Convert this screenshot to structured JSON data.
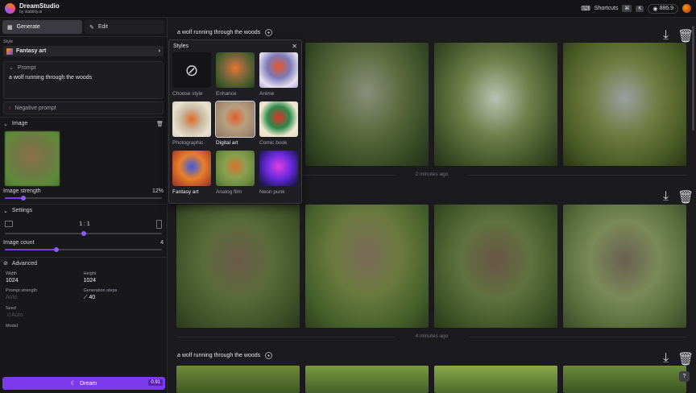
{
  "app": {
    "title": "DreamStudio",
    "subtitle": "by stability.ai"
  },
  "topbar": {
    "shortcuts_label": "Shortcuts",
    "kbd1": "⌘",
    "kbd2": "K",
    "credits": "886.9"
  },
  "tabs": [
    {
      "label": "Generate"
    },
    {
      "label": "Edit"
    }
  ],
  "style": {
    "label": "Style",
    "value": "Fantasy art"
  },
  "prompt": {
    "label": "Prompt",
    "text": "a wolf running through the woods"
  },
  "negative_prompt": {
    "label": "Negative prompt"
  },
  "image": {
    "label": "Image",
    "strength_label": "Image strength",
    "strength_value": "12%",
    "strength_fraction": 0.12
  },
  "settings": {
    "label": "Settings",
    "ratio": "1 : 1",
    "ratio_fraction": 0.5,
    "image_count_label": "Image count",
    "image_count": "4",
    "image_count_fraction": 0.33,
    "advanced_label": "Advanced",
    "width_label": "Width",
    "width": "1024",
    "height_label": "Height",
    "height": "1024",
    "prompt_strength_label": "Prompt strength",
    "prompt_strength": "Auto",
    "steps_label": "Generation steps",
    "steps": "40",
    "seed_label": "Seed",
    "seed": "Auto",
    "model_label": "Model"
  },
  "dream": {
    "label": "Dream",
    "cost": "0.91"
  },
  "generations": [
    {
      "prompt": "a wolf running through the woods",
      "time": "2 minutes ago"
    },
    {
      "prompt": "",
      "time": "4 minutes ago"
    },
    {
      "prompt": "a wolf running through the woods",
      "time": ""
    }
  ],
  "styles_popup": {
    "title": "Styles",
    "items": [
      {
        "name": "Choose style"
      },
      {
        "name": "Enhance"
      },
      {
        "name": "Anime"
      },
      {
        "name": "Photographic"
      },
      {
        "name": "Digital art"
      },
      {
        "name": "Comic book"
      },
      {
        "name": "Fantasy art"
      },
      {
        "name": "Analog film"
      },
      {
        "name": "Neon punk"
      }
    ]
  },
  "help": {
    "label": "?"
  },
  "colors": {
    "accent": "#7c3aed",
    "background": "#1b1b1e",
    "sidebar": "#18181b"
  }
}
